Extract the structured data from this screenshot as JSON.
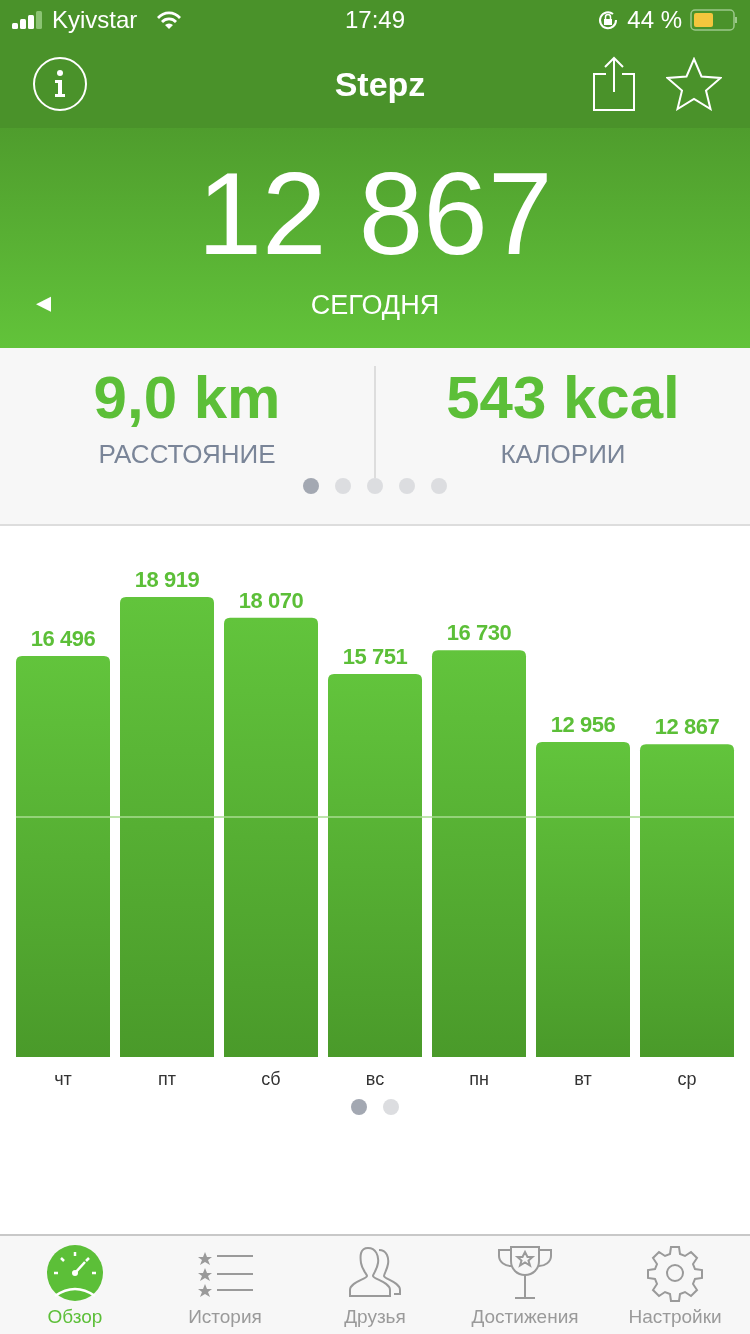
{
  "status_bar": {
    "carrier": "Kyivstar",
    "time": "17:49",
    "battery": "44 %"
  },
  "nav": {
    "title": "Stepz"
  },
  "today": {
    "steps": "12 867",
    "label": "СЕГОДНЯ",
    "prev": "◂"
  },
  "stats": [
    {
      "value": "9,0 km",
      "label": "РАССТОЯНИЕ"
    },
    {
      "value": "543 kcal",
      "label": "КАЛОРИИ"
    }
  ],
  "stats_pages": [
    {
      "selected": true
    },
    {
      "selected": false
    },
    {
      "selected": false
    },
    {
      "selected": false
    },
    {
      "selected": false
    }
  ],
  "chart": {
    "chart_data": {
      "type": "bar",
      "categories": [
        "чт",
        "пт",
        "сб",
        "вс",
        "пн",
        "вт",
        "ср"
      ],
      "values": [
        16496,
        18919,
        18070,
        15751,
        16730,
        12956,
        12867
      ],
      "value_labels": [
        "16 496",
        "18 919",
        "18 070",
        "15 751",
        "16 730",
        "12 956",
        "12 867"
      ],
      "data_labels": true
    }
  },
  "chart_pages": [
    {
      "selected": true
    },
    {
      "selected": false
    }
  ],
  "tabs": [
    {
      "kind": "overview",
      "label": "Обзор",
      "selected": true
    },
    {
      "kind": "history",
      "label": "История",
      "selected": false
    },
    {
      "kind": "friends",
      "label": "Друзья",
      "selected": false
    },
    {
      "kind": "achievements",
      "label": "Достижения",
      "selected": false
    },
    {
      "kind": "settings",
      "label": "Настройки",
      "selected": false
    }
  ]
}
